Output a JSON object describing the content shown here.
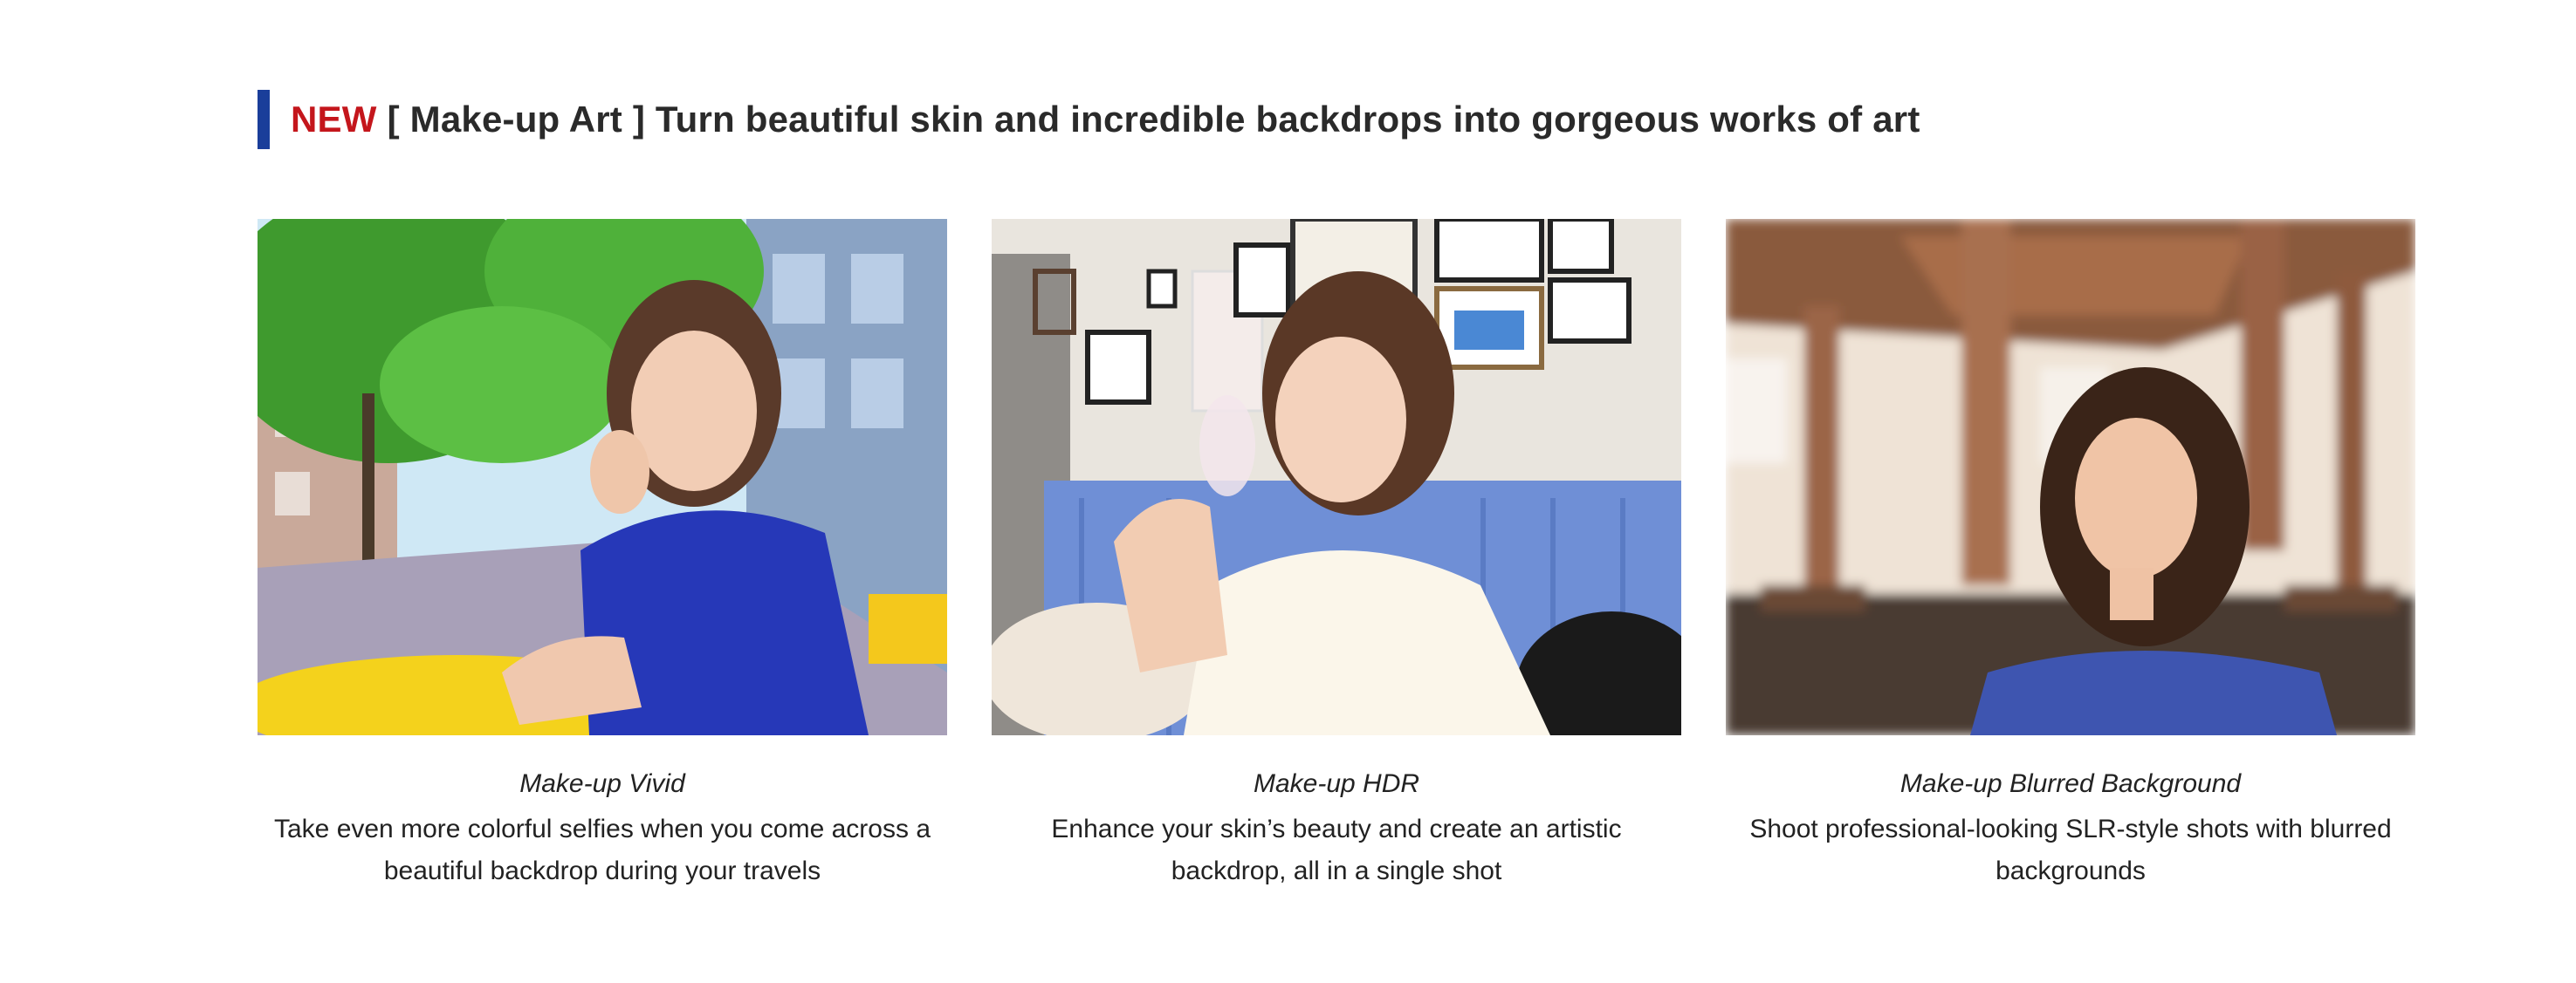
{
  "header": {
    "new_label": "NEW",
    "title": "[ Make-up Art ] Turn beautiful skin and incredible backdrops into gorgeous works of art",
    "accent_color": "#1a3e9a",
    "new_color": "#c4161c"
  },
  "cards": [
    {
      "mode_name": "Make-up Vivid",
      "description": "Take even more colorful selfies when you come across a beautiful backdrop during your travels"
    },
    {
      "mode_name": "Make-up HDR",
      "description": "Enhance your skin’s beauty and create an artistic backdrop, all in a single shot"
    },
    {
      "mode_name": "Make-up Blurred Background",
      "description": "Shoot professional-looking SLR-style shots with blurred backgrounds"
    }
  ]
}
